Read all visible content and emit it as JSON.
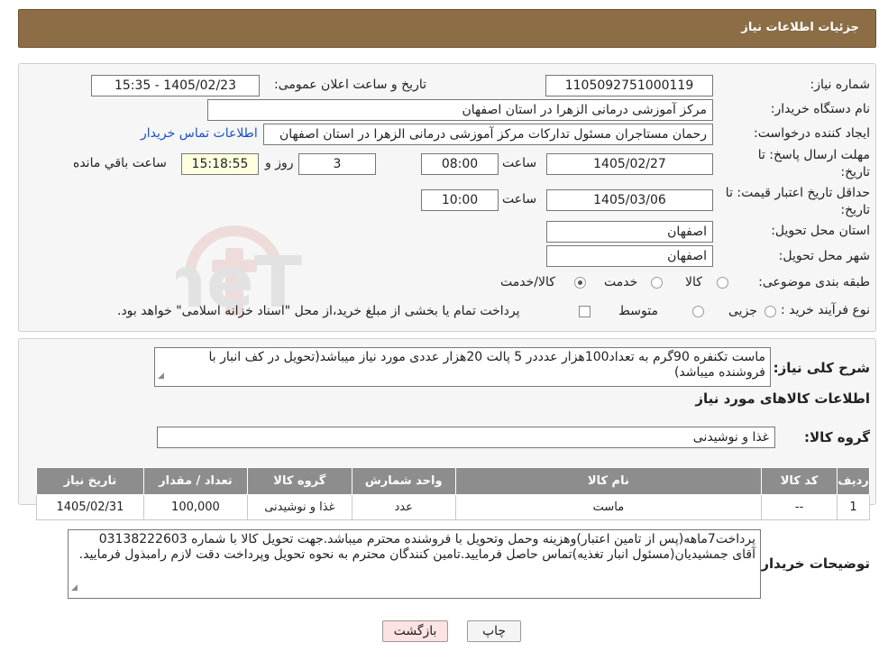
{
  "header": {
    "title": "جزئیات اطلاعات نیاز"
  },
  "watermark": {
    "text": "AriaTender.neT"
  },
  "fields": {
    "need_number_label": "شماره نیاز:",
    "need_number": "1105092751000119",
    "announce_label": "تاریخ و ساعت اعلان عمومی:",
    "announce_value": "1405/02/23 - 15:35",
    "buyer_org_label": "نام دستگاه خریدار:",
    "buyer_org": "مرکز آموزشی درمانی الزهرا در استان اصفهان",
    "creator_label": "ایجاد کننده درخواست:",
    "creator": "رحمان مستاجران مسئول تدارکات مرکز آموزشی درمانی الزهرا در استان اصفهان",
    "contact_link": "اطلاعات تماس خریدار",
    "deadline_label_1": "مهلت ارسال پاسخ: تا",
    "deadline_label_2": "تاریخ:",
    "deadline_date": "1405/02/27",
    "time_label": "ساعت",
    "deadline_time": "08:00",
    "days_value": "3",
    "days_label": "روز و",
    "remaining_time": "15:18:55",
    "remaining_label": "ساعت باقي مانده",
    "validity_label_1": "حداقل تاریخ اعتبار قیمت: تا",
    "validity_label_2": "تاریخ:",
    "validity_date": "1405/03/06",
    "validity_time_label": "ساعت",
    "validity_time": "10:00",
    "province_label": "استان محل تحویل:",
    "province": "اصفهان",
    "city_label": "شهر محل تحویل:",
    "city": "اصفهان",
    "category_label": "طبقه بندی موضوعی:",
    "category_options": [
      "کالا",
      "خدمت",
      "کالا/خدمت"
    ],
    "process_label": "نوع فرآیند خرید :",
    "process_options": [
      "جزیی",
      "متوسط"
    ],
    "payment_note": "پرداخت تمام یا بخشی از مبلغ خرید،از محل \"اسناد خزانه اسلامی\" خواهد بود."
  },
  "description": {
    "label": "شرح کلی نیاز:",
    "text": "ماست تکنفره 90گرم به تعداد100هزار عدددر 5 پالت 20هزار عددی مورد نیاز میباشد(تحویل در کف انبار با فروشنده میباشد)"
  },
  "goods": {
    "section_title": "اطلاعات کالاهای مورد نیاز",
    "group_label": "گروه کالا:",
    "group_value": "غذا و نوشیدنی",
    "table": {
      "headers": [
        "ردیف",
        "کد کالا",
        "نام کالا",
        "واحد شمارش",
        "گروه کالا",
        "تعداد / مقدار",
        "تاریخ نیاز"
      ],
      "rows": [
        [
          "1",
          "--",
          "ماست",
          "عدد",
          "غذا و نوشیدنی",
          "100,000",
          "1405/02/31"
        ]
      ]
    }
  },
  "buyer_notes": {
    "label": "توضیحات خریدار:",
    "text": "پرداخت7ماهه(پس از تامین اعتبار)وهزینه وحمل وتحویل با فروشنده محترم میباشد.جهت تحویل کالا با شماره 03138222603 آقای جمشیدیان(مسئول انبار تغذیه)تماس حاصل فرمایید.تامین کنندگان محترم به نحوه تحویل وپرداخت دقت لازم رامبذول فرمایید."
  },
  "buttons": {
    "print": "چاپ",
    "back": "بازگشت"
  },
  "colors": {
    "header_bg": "#8c6d46",
    "table_header_bg": "#8d8d8d",
    "back_button_bg": "#fde3e3",
    "link": "#1a4fcc"
  }
}
